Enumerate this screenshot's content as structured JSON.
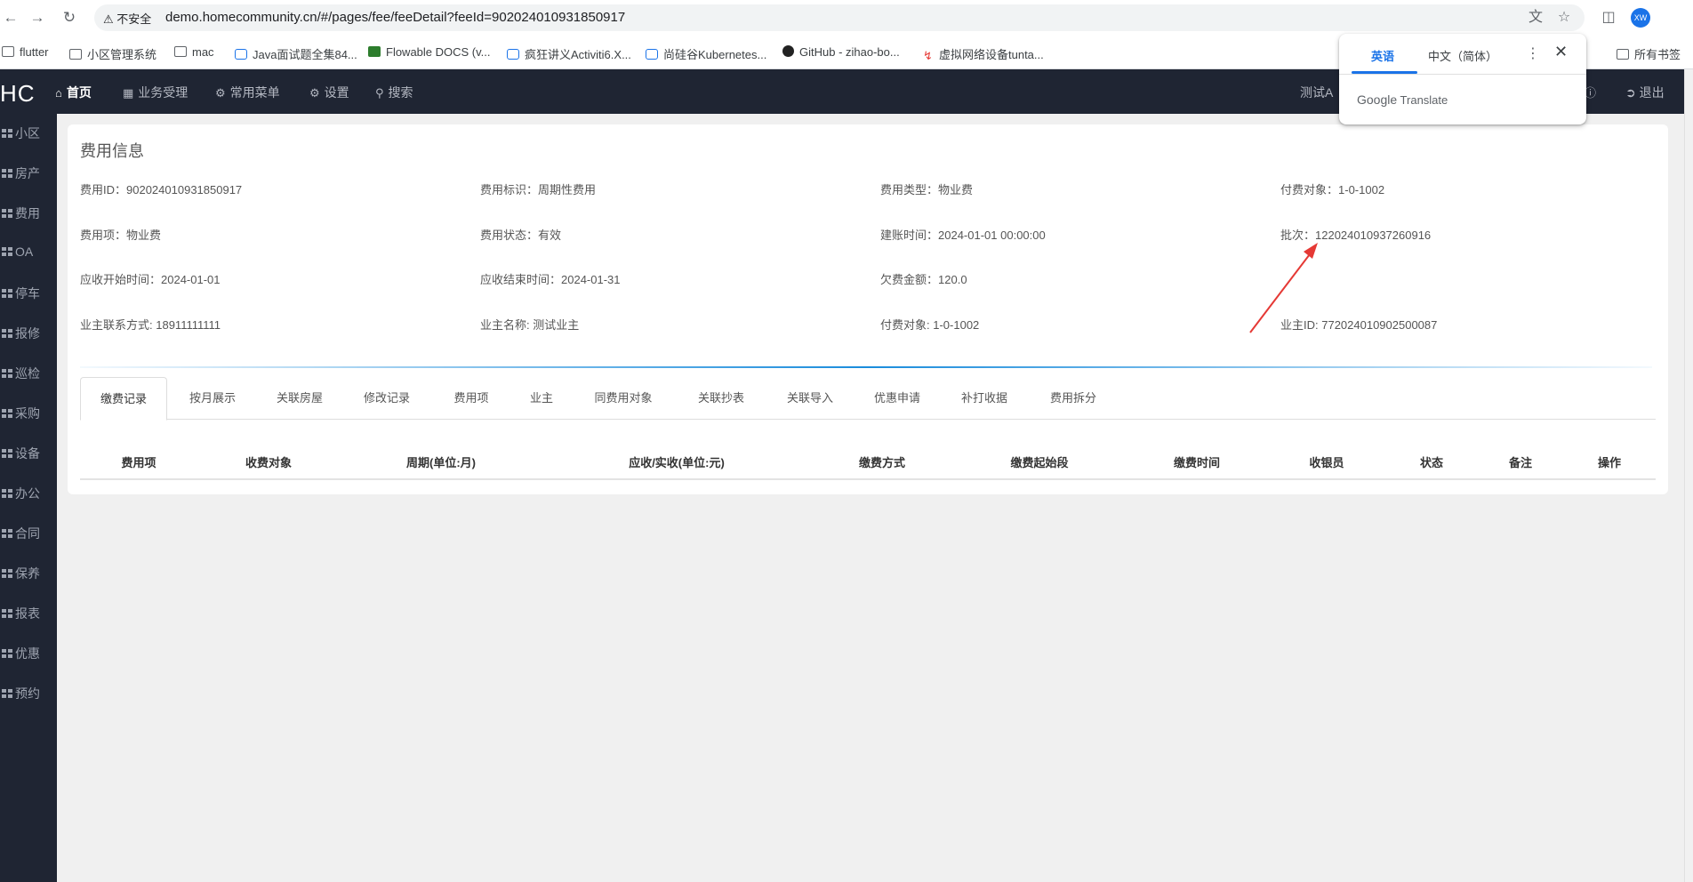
{
  "browser": {
    "back_icon": "arrow-left-icon",
    "forward_icon": "arrow-right-icon",
    "reload_icon": "reload-icon",
    "security_label": "不安全",
    "url": "demo.homecommunity.cn/#/pages/fee/feeDetail?feeId=902024010931850917",
    "avatar_text": "XW",
    "bookmarks": [
      {
        "label": "flutter",
        "icon": "folder-icon"
      },
      {
        "label": "小区管理系统",
        "icon": "folder-icon"
      },
      {
        "label": "mac",
        "icon": "folder-icon"
      },
      {
        "label": "Java面试题全集84...",
        "icon": "bilibili-icon"
      },
      {
        "label": "Flowable DOCS (v...",
        "icon": "flowable-icon"
      },
      {
        "label": "疯狂讲义Activiti6.X...",
        "icon": "bilibili-icon"
      },
      {
        "label": "尚硅谷Kubernetes...",
        "icon": "bilibili-icon"
      },
      {
        "label": "GitHub - zihao-bo...",
        "icon": "github-icon"
      },
      {
        "label": "虚拟网络设备tunta...",
        "icon": "bolt-icon"
      }
    ],
    "all_bookmarks": "所有书签"
  },
  "translate_popup": {
    "lang_source": "英语",
    "lang_target": "中文（简体）",
    "brand_google": "Google",
    "brand_translate": "Translate"
  },
  "topnav": {
    "logo": "HC",
    "items": [
      {
        "label": "首页",
        "icon": "home-icon"
      },
      {
        "label": "业务受理",
        "icon": "calculator-icon"
      },
      {
        "label": "常用菜单",
        "icon": "sitemap-icon"
      },
      {
        "label": "设置",
        "icon": "gear-icon"
      },
      {
        "label": "搜索",
        "icon": "search-icon"
      }
    ],
    "user": "测试A",
    "logout": "退出"
  },
  "sidebar": {
    "items": [
      "小区",
      "房产",
      "费用",
      "OA",
      "停车",
      "报修",
      "巡检",
      "采购",
      "设备",
      "办公",
      "合同",
      "保养",
      "报表",
      "优惠",
      "预约"
    ]
  },
  "fee_info": {
    "title": "费用信息",
    "fields": [
      {
        "label": "费用ID：",
        "value": "902024010931850917"
      },
      {
        "label": "费用标识：",
        "value": "周期性费用"
      },
      {
        "label": "费用类型：",
        "value": "物业费"
      },
      {
        "label": "付费对象：",
        "value": "1-0-1002"
      },
      {
        "label": "费用项：",
        "value": "物业费"
      },
      {
        "label": "费用状态：",
        "value": "有效"
      },
      {
        "label": "建账时间：",
        "value": "2024-01-01 00:00:00"
      },
      {
        "label": "批次：",
        "value": "122024010937260916"
      },
      {
        "label": "应收开始时间：",
        "value": "2024-01-01"
      },
      {
        "label": "应收结束时间：",
        "value": "2024-01-31"
      },
      {
        "label": "欠费金额：",
        "value": "120.0"
      },
      {
        "label": "",
        "value": ""
      },
      {
        "label": "业主联系方式: ",
        "value": "18911111111"
      },
      {
        "label": "业主名称: ",
        "value": "测试业主"
      },
      {
        "label": "付费对象: ",
        "value": "1-0-1002"
      },
      {
        "label": "业主ID: ",
        "value": "772024010902500087"
      }
    ]
  },
  "tabs": [
    "缴费记录",
    "按月展示",
    "关联房屋",
    "修改记录",
    "费用项",
    "业主",
    "同费用对象",
    "关联抄表",
    "关联导入",
    "优惠申请",
    "补打收据",
    "费用拆分"
  ],
  "table": {
    "headers": [
      "费用项",
      "收费对象",
      "周期(单位:月)",
      "应收/实收(单位:元)",
      "缴费方式",
      "缴费起始段",
      "缴费时间",
      "收银员",
      "状态",
      "备注",
      "操作"
    ]
  },
  "colors": {
    "nav_bg": "#1f2533",
    "accent": "#1a8cdc",
    "annotation_arrow": "#e53935",
    "translate_accent": "#1a73e8"
  }
}
